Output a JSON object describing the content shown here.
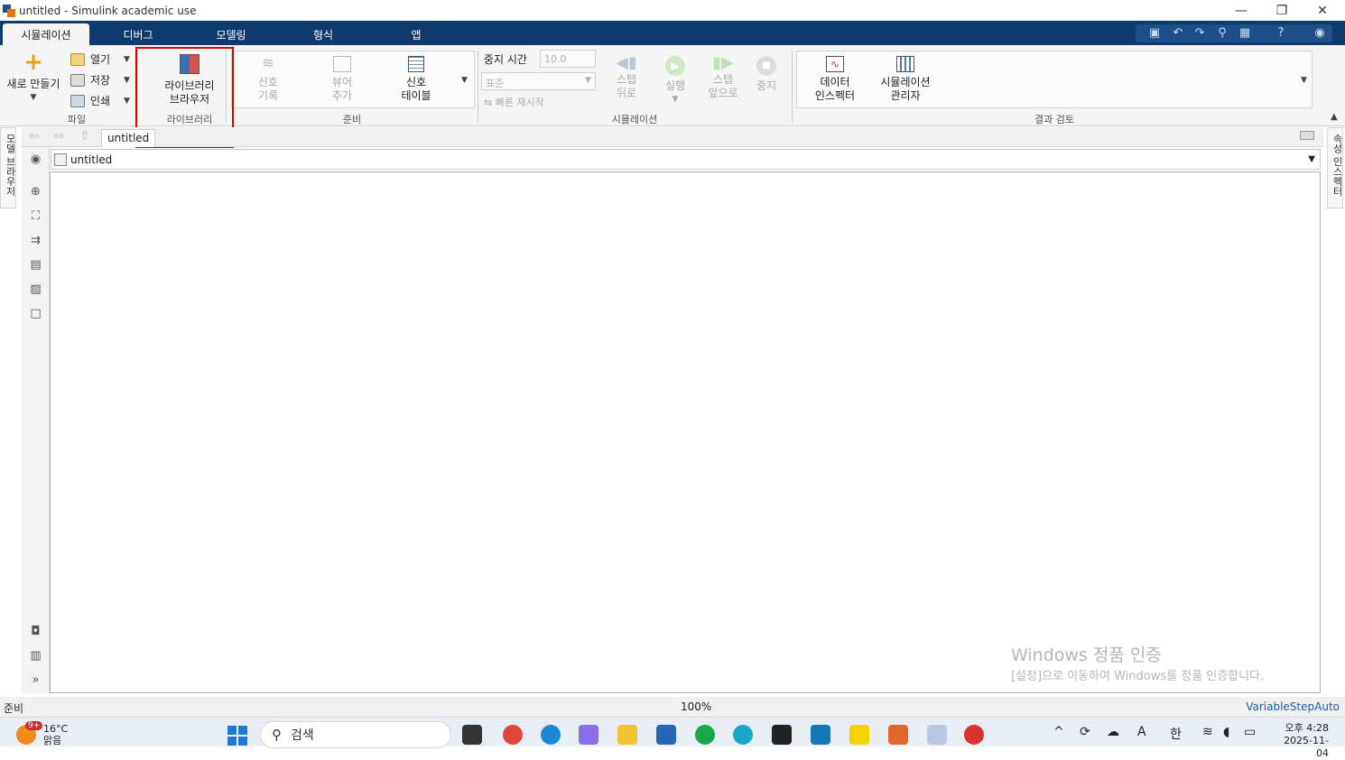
{
  "window": {
    "title": "untitled - Simulink academic use",
    "minimize_glyph": "—",
    "restore_glyph": "❐",
    "close_glyph": "✕"
  },
  "tabs": [
    {
      "label": "시뮬레이션"
    },
    {
      "label": "디버그"
    },
    {
      "label": "모델링"
    },
    {
      "label": "형식"
    },
    {
      "label": "앱"
    }
  ],
  "ribbon": {
    "file": {
      "new_label": "새로 만들기",
      "open_label": "열기",
      "save_label": "저장",
      "print_label": "인쇄",
      "group_label": "파일"
    },
    "library": {
      "browser_label_1": "라이브러리",
      "browser_label_2": "브라우저",
      "group_label": "라이브러리"
    },
    "prepare": {
      "log_signals_1": "신호",
      "log_signals_2": "기록",
      "add_viewer_1": "뷰어",
      "add_viewer_2": "추가",
      "signal_table_1": "신호",
      "signal_table_2": "테이블",
      "group_label": "준비"
    },
    "simulation": {
      "stop_time_label": "중지 시간",
      "stop_time_value": "10.0",
      "mode_value": "표준",
      "fast_restart_label": "빠른 재시작",
      "step_back_1": "스텝",
      "step_back_2": "뒤로",
      "run_label": "실행",
      "step_forward_1": "스텝",
      "step_forward_2": "앞으로",
      "stop_label": "중지",
      "group_label": "시뮬레이션"
    },
    "review": {
      "data_inspector_1": "데이터",
      "data_inspector_2": "인스펙터",
      "sim_manager_1": "시뮬레이션",
      "sim_manager_2": "관리자",
      "group_label": "결과 검토"
    }
  },
  "side": {
    "left_label": "모델 브라우저",
    "right_label": "속성 인스펙터"
  },
  "breadcrumb": {
    "tab_label": "untitled",
    "address": "untitled"
  },
  "watermark": {
    "line1": "Windows 정품 인증",
    "line2": "[설정]으로 이동하여 Windows를 정품 인증합니다."
  },
  "status": {
    "left": "준비",
    "zoom": "100%",
    "solver": "VariableStepAuto"
  },
  "taskbar": {
    "weather_temp": "16°C",
    "weather_cond": "맑음",
    "weather_badge": "9+",
    "search_label": "검색",
    "ime_mode": "한",
    "ime_alpha": "A",
    "time": "오후 4:28",
    "date": "2025-11-04"
  },
  "colors": {
    "tabbar": "#0e3a6e",
    "highlight": "#e00000"
  }
}
